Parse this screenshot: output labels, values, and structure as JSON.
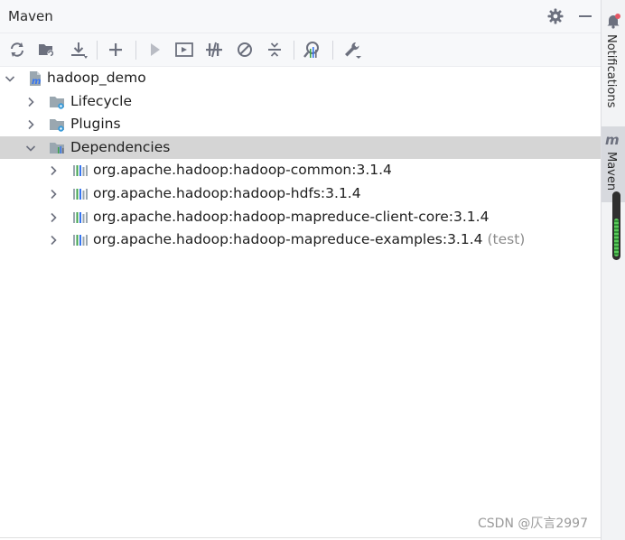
{
  "header": {
    "title": "Maven"
  },
  "tree": {
    "root": {
      "label": "hadoop_demo"
    },
    "lifecycle": {
      "label": "Lifecycle"
    },
    "plugins": {
      "label": "Plugins"
    },
    "dependencies": {
      "label": "Dependencies",
      "items": [
        {
          "label": "org.apache.hadoop:hadoop-common:3.1.4",
          "scope": ""
        },
        {
          "label": "org.apache.hadoop:hadoop-hdfs:3.1.4",
          "scope": ""
        },
        {
          "label": "org.apache.hadoop:hadoop-mapreduce-client-core:3.1.4",
          "scope": ""
        },
        {
          "label": "org.apache.hadoop:hadoop-mapreduce-examples:3.1.4",
          "scope": "(test)"
        }
      ]
    }
  },
  "sidebar": {
    "notifications_label": "Notifications",
    "maven_label": "Maven"
  },
  "watermark": "CSDN @仄言2997"
}
